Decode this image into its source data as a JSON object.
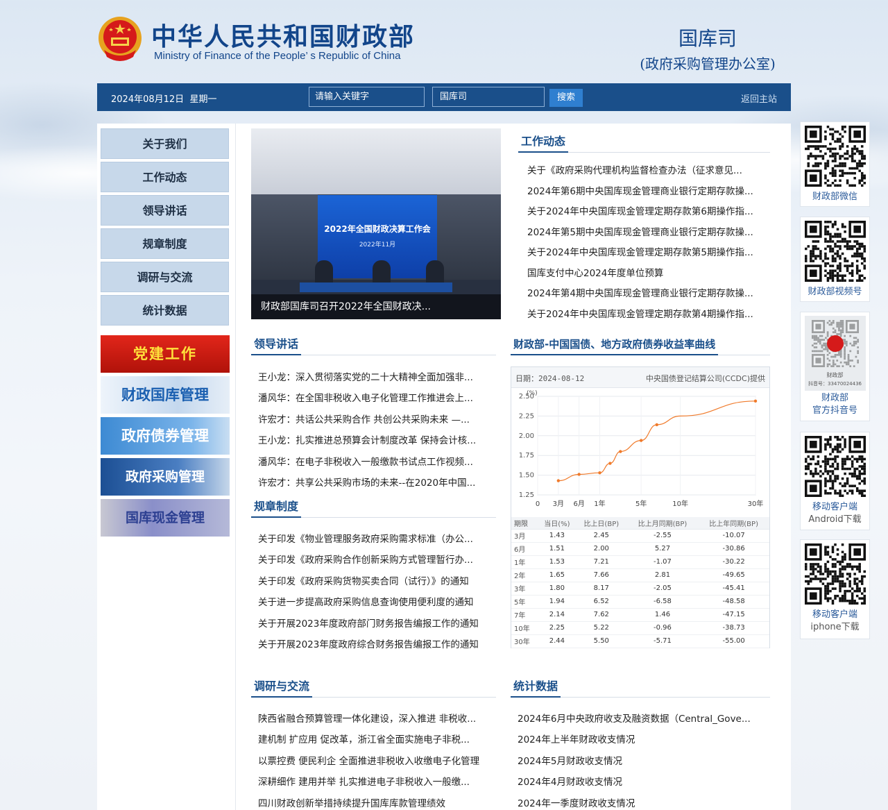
{
  "header": {
    "title_cn": "中华人民共和国财政部",
    "title_en": "Ministry of Finance of the People’ s Republic of China",
    "dept_name": "国库司",
    "dept_sub": "(政府采购管理办公室)"
  },
  "bar": {
    "date": "2024年08月12日",
    "weekday": "星期一",
    "search_placeholder": "请输入关键字",
    "scope": "国库司",
    "search_label": "搜索",
    "home_label": "返回主站"
  },
  "menu": [
    "关于我们",
    "工作动态",
    "领导讲话",
    "规章制度",
    "调研与交流",
    "统计数据"
  ],
  "banners": [
    "党建工作",
    "财政国库管理",
    "政府债券管理",
    "政府采购管理",
    "国库现金管理"
  ],
  "photo": {
    "screen_title": "2022年全国财政决算工作会",
    "screen_date": "2022年11月",
    "caption": "财政部国库司召开2022年全国财政决..."
  },
  "work_news": {
    "title": "工作动态",
    "items": [
      "关于《政府采购代理机构监督检查办法（征求意见...",
      "2024年第6期中央国库现金管理商业银行定期存款操...",
      "关于2024年中央国库现金管理定期存款第6期操作指...",
      "2024年第5期中央国库现金管理商业银行定期存款操...",
      "关于2024年中央国库现金管理定期存款第5期操作指...",
      "国库支付中心2024年度单位预算",
      "2024年第4期中央国库现金管理商业银行定期存款操...",
      "关于2024年中央国库现金管理定期存款第4期操作指..."
    ]
  },
  "leader": {
    "title": "领导讲话",
    "items": [
      "王小龙：深入贯彻落实党的二十大精神全面加强非...",
      "潘风华：在全国非税收入电子化管理工作推进会上...",
      "许宏才：共话公共采购合作 共创公共采购未来 —...",
      "王小龙：扎实推进总预算会计制度改革 保持会计核...",
      "潘风华：在电子非税收入一般缴款书试点工作视频...",
      "许宏才：共享公共采购市场的未来--在2020年中国..."
    ]
  },
  "rules": {
    "title": "规章制度",
    "items": [
      "关于印发《物业管理服务政府采购需求标准（办公...",
      "关于印发《政府采购合作创新采购方式管理暂行办...",
      "关于印发《政府采购货物买卖合同（试行）》的通知",
      "关于进一步提高政府采购信息查询使用便利度的通知",
      "关于开展2023年度政府部门财务报告编报工作的通知",
      "关于开展2023年度政府综合财务报告编报工作的通知"
    ]
  },
  "research": {
    "title": "调研与交流",
    "items": [
      "陕西省融合预算管理一体化建设，深入推进 非税收...",
      "建机制 扩应用 促改革，浙江省全面实施电子非税...",
      "以票控费 便民利企 全面推进非税收入收缴电子化管理",
      "深耕细作 建用并举 扎实推进电子非税收入一般缴...",
      "四川财政创新举措持续提升国库库款管理绩效"
    ]
  },
  "stats": {
    "title": "统计数据",
    "items": [
      "2024年6月中央政府收支及融资数据（Central_Gove...",
      "2024年上半年财政收支情况",
      "2024年5月财政收支情况",
      "2024年4月财政收支情况",
      "2024年一季度财政收支情况"
    ]
  },
  "curve": {
    "title": "财政部-中国国债、地方政府债券收益率曲线",
    "date_label": "日期：2024-08-12",
    "provider": "中央国债登记结算公司(CCDC)提供",
    "table_headers": [
      "期限",
      "当日(%)",
      "比上日(BP)",
      "比上月同期(BP)",
      "比上年同期(BP)"
    ],
    "table_rows": [
      [
        "3月",
        "1.43",
        "2.45",
        "-2.55",
        "-10.07"
      ],
      [
        "6月",
        "1.51",
        "2.00",
        "5.27",
        "-30.86"
      ],
      [
        "1年",
        "1.53",
        "7.21",
        "-1.07",
        "-30.22"
      ],
      [
        "2年",
        "1.65",
        "7.66",
        "2.81",
        "-49.65"
      ],
      [
        "3年",
        "1.80",
        "8.17",
        "-2.05",
        "-45.41"
      ],
      [
        "5年",
        "1.94",
        "6.52",
        "-6.58",
        "-48.58"
      ],
      [
        "7年",
        "2.14",
        "7.62",
        "1.46",
        "-47.15"
      ],
      [
        "10年",
        "2.25",
        "5.22",
        "-0.96",
        "-38.73"
      ],
      [
        "30年",
        "2.44",
        "5.50",
        "-5.71",
        "-55.00"
      ]
    ]
  },
  "chart_data": {
    "type": "line",
    "title": "",
    "xlabel": "",
    "ylabel": "(%)",
    "x_ticks": [
      "0",
      "3月",
      "6月",
      "1年",
      "5年",
      "10年",
      "30年"
    ],
    "x_tick_years": [
      0,
      0.25,
      0.5,
      1,
      5,
      10,
      30
    ],
    "y_ticks": [
      "1.25",
      "1.50",
      "1.75",
      "2.00",
      "2.25",
      "2.50"
    ],
    "ylim": [
      1.25,
      2.5
    ],
    "grid": true,
    "color": "#f07a2a",
    "points": [
      {
        "term": "3月",
        "y": 1.43
      },
      {
        "term": "6月",
        "y": 1.51
      },
      {
        "term": "1年",
        "y": 1.53
      },
      {
        "term": "2年",
        "y": 1.65
      },
      {
        "term": "3年",
        "y": 1.8
      },
      {
        "term": "5年",
        "y": 1.94
      },
      {
        "term": "7年",
        "y": 2.14
      },
      {
        "term": "10年",
        "y": 2.25
      },
      {
        "term": "30年",
        "y": 2.44
      }
    ]
  },
  "qr": [
    {
      "label": "财政部微信",
      "sub": ""
    },
    {
      "label": "财政部视频号",
      "sub": ""
    },
    {
      "label": "财政部",
      "sub": "官方抖音号"
    },
    {
      "label": "移动客户端",
      "sub": "Android下载"
    },
    {
      "label": "移动客户端",
      "sub": "iphone下载"
    }
  ],
  "douyin_card": {
    "name": "财政部",
    "id": "抖音号：33470024436"
  }
}
